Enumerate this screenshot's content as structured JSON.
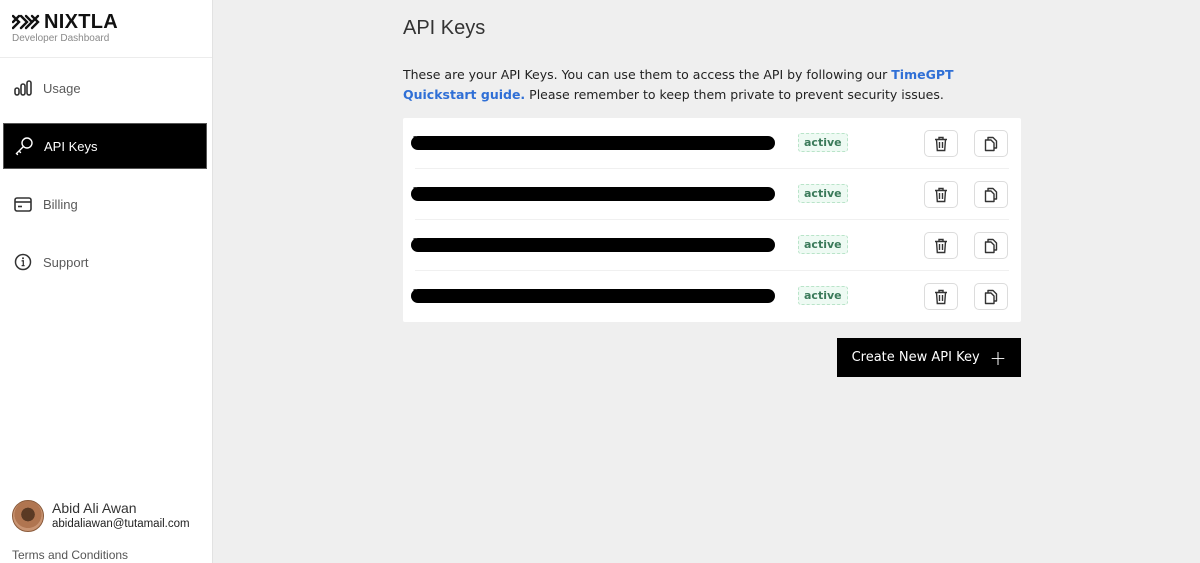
{
  "brand": {
    "name": "NIXTLA",
    "subtitle": "Developer Dashboard",
    "logo_icon": "nixtla-logo-icon"
  },
  "sidebar": {
    "items": [
      {
        "label": "Usage",
        "icon": "bar-chart-icon",
        "active": false
      },
      {
        "label": "API Keys",
        "icon": "key-icon",
        "active": true
      },
      {
        "label": "Billing",
        "icon": "credit-card-icon",
        "active": false
      },
      {
        "label": "Support",
        "icon": "info-icon",
        "active": false
      }
    ],
    "user": {
      "name": "Abid Ali Awan",
      "email": "abidaliawan@tutamail.com"
    },
    "terms_label": "Terms and Conditions"
  },
  "main": {
    "title": "API Keys",
    "intro_before_link": "These are your API Keys. You can use them to access the API by following our ",
    "intro_link": "TimeGPT Quickstart guide.",
    "intro_after_link": " Please remember to keep them private to prevent security issues.",
    "keys": [
      {
        "value": "[redacted]",
        "status": "active"
      },
      {
        "value": "[redacted]",
        "status": "active"
      },
      {
        "value": "[redacted]",
        "status": "active"
      },
      {
        "value": "[redacted]",
        "status": "active"
      }
    ],
    "create_button_label": "Create New API Key",
    "create_button_icon": "+"
  },
  "colors": {
    "accent_link": "#2f6fd6",
    "active_badge_text": "#3b7a5a",
    "active_badge_bg": "#eefaf3",
    "nav_active_bg": "#000000",
    "page_bg": "#efefef"
  }
}
